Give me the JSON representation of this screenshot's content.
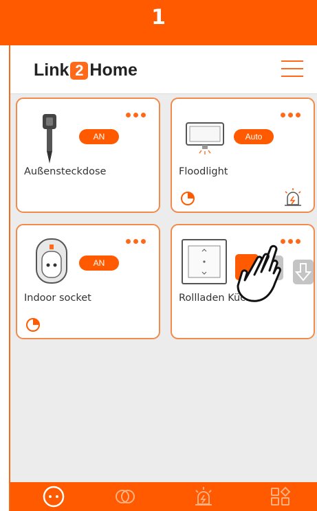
{
  "tutorial": {
    "step": "1"
  },
  "header": {
    "brand_left": "Link",
    "brand_badge": "2",
    "brand_right": "Home",
    "menu_icon": "hamburger-icon"
  },
  "devices": [
    {
      "label": "Außensteckdose",
      "status": "AN",
      "icon": "outdoor-socket-icon"
    },
    {
      "label": "Floodlight",
      "status": "Auto",
      "icon": "floodlight-icon"
    },
    {
      "label": "Indoor socket",
      "status": "AN",
      "icon": "indoor-socket-icon"
    },
    {
      "label": "Rollladen Küche",
      "icon": "shutter-switch-icon"
    }
  ],
  "bottom_nav": [
    "devices-icon",
    "scenes-icon",
    "alarm-icon",
    "more-icon"
  ],
  "colors": {
    "accent": "#ff5a00",
    "card_border": "#f28a4c",
    "background": "#ececec"
  }
}
